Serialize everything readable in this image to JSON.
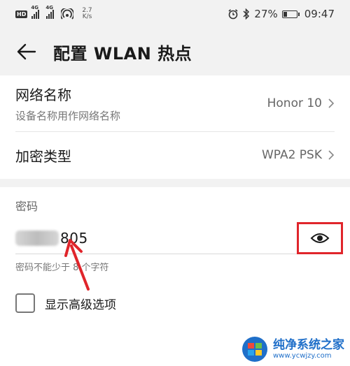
{
  "status_bar": {
    "network_1": "4G",
    "network_2": "4G",
    "speed_value": "2.7",
    "speed_unit": "K/s",
    "battery_percent": "27%",
    "battery_level": 0.27,
    "time": "09:47"
  },
  "header": {
    "title": "配置 WLAN 热点"
  },
  "settings": {
    "network_name": {
      "label": "网络名称",
      "sublabel": "设备名称用作网络名称",
      "value": "Honor 10"
    },
    "encryption": {
      "label": "加密类型",
      "value": "WPA2 PSK"
    }
  },
  "password": {
    "section_label": "密码",
    "visible_suffix": "805",
    "hint": "密码不能少于 8 个字符"
  },
  "advanced": {
    "label": "显示高级选项"
  },
  "watermark": {
    "name": "纯净系统之家",
    "url": "www.ycwjzy.com"
  },
  "colors": {
    "highlight": "#e0252b",
    "watermark_blue": "#1f6fc9"
  }
}
